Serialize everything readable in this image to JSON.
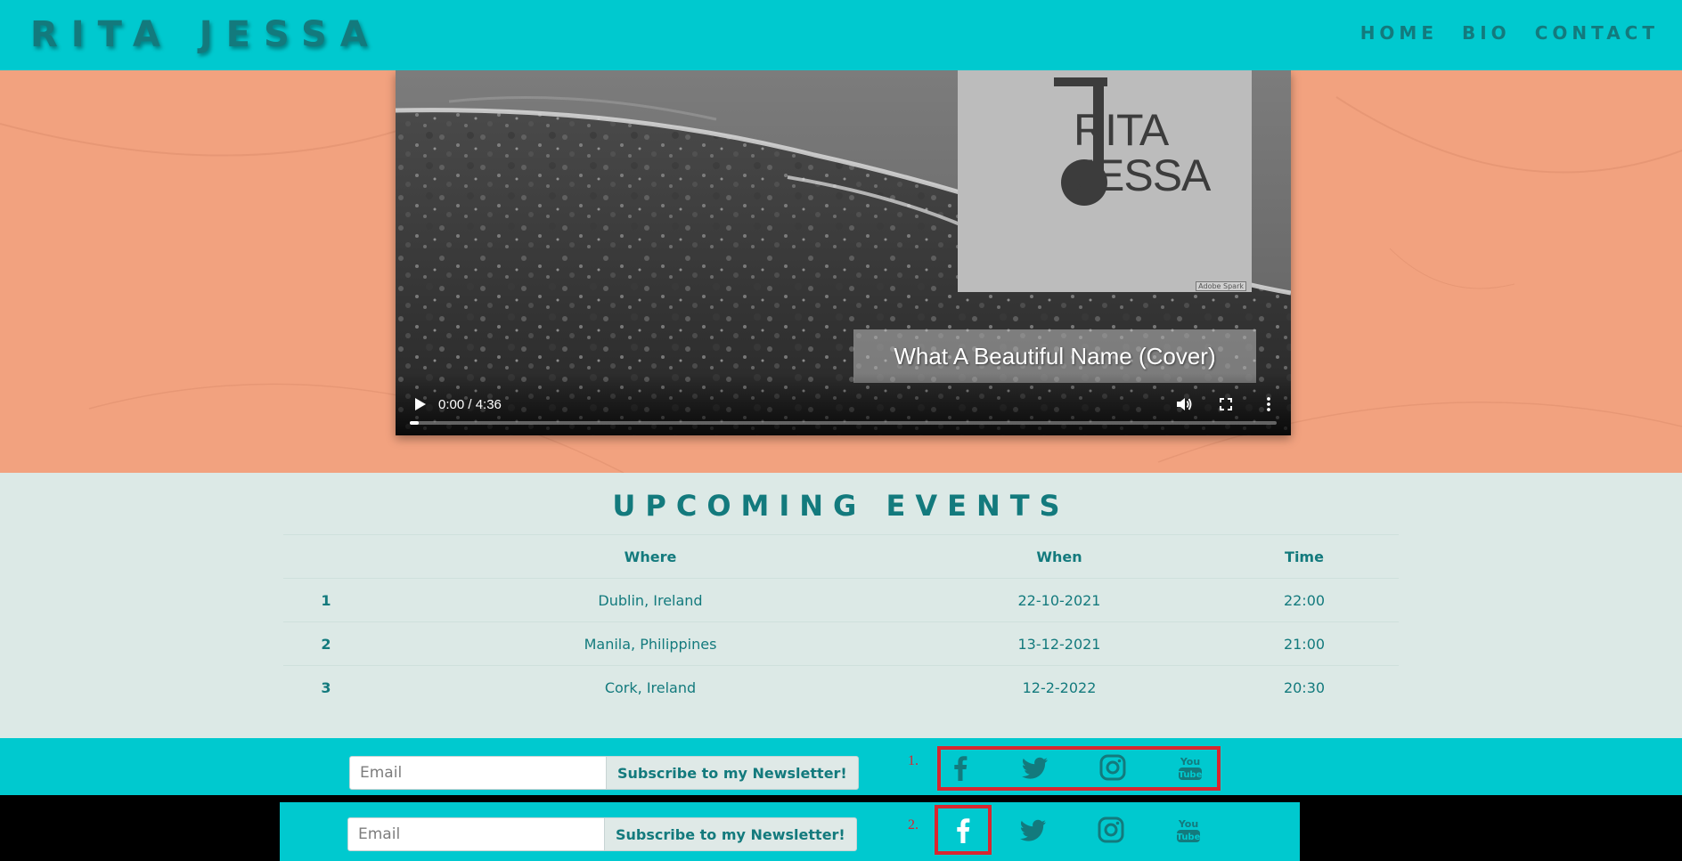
{
  "brand": {
    "name": "RITA JESSA"
  },
  "nav": {
    "items": [
      "HOME",
      "BIO",
      "CONTACT"
    ]
  },
  "video": {
    "logo_line1": "RITA",
    "logo_line2": "JESSA",
    "watermark": "Adobe Spark",
    "title": "What A Beautiful Name (Cover)",
    "time": "0:00 / 4:36",
    "progress": 0.01
  },
  "events": {
    "title": "UPCOMING EVENTS",
    "headers": {
      "num": "",
      "where": "Where",
      "when": "When",
      "time": "Time"
    },
    "rows": [
      {
        "num": "1",
        "where": "Dublin, Ireland",
        "when": "22-10-2021",
        "time": "22:00"
      },
      {
        "num": "2",
        "where": "Manila, Philippines",
        "when": "13-12-2021",
        "time": "21:00"
      },
      {
        "num": "3",
        "where": "Cork, Ireland",
        "when": "12-2-2022",
        "time": "20:30"
      }
    ]
  },
  "footer1": {
    "email_placeholder": "Email",
    "subscribe_label": "Subscribe to my Newsletter!",
    "marker": "1.",
    "social_icons": [
      "facebook-icon",
      "twitter-icon",
      "instagram-icon",
      "youtube-icon"
    ],
    "icon_color": "#137a7d"
  },
  "footer2": {
    "email_placeholder": "Email",
    "subscribe_label": "Subscribe to my Newsletter!",
    "marker": "2.",
    "social_icons": [
      "facebook-icon",
      "twitter-icon",
      "instagram-icon",
      "youtube-icon"
    ],
    "highlighted_icon": "facebook-icon",
    "highlight_color": "#ffffff"
  },
  "colors": {
    "teal_bar": "#00c9cf",
    "teal_text": "#137a7d",
    "hero_bg": "#f2a27f",
    "events_bg": "#dce9e6",
    "annotation_red": "#d8262f"
  }
}
